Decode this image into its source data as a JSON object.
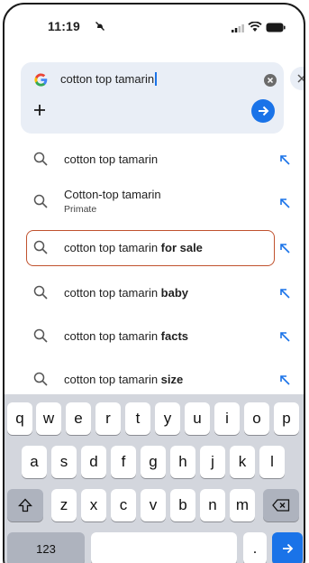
{
  "status_bar": {
    "time": "11:19"
  },
  "search": {
    "query": "cotton top tamarin"
  },
  "suggestions": [
    {
      "prefix": "cotton top tamarin",
      "bold": "",
      "subtitle": ""
    },
    {
      "prefix": "Cotton-top tamarin",
      "bold": "",
      "subtitle": "Primate"
    },
    {
      "prefix": "cotton top tamarin ",
      "bold": "for sale",
      "subtitle": ""
    },
    {
      "prefix": "cotton top tamarin ",
      "bold": "baby",
      "subtitle": ""
    },
    {
      "prefix": "cotton top tamarin ",
      "bold": "facts",
      "subtitle": ""
    },
    {
      "prefix": "cotton top tamarin ",
      "bold": "size",
      "subtitle": ""
    }
  ],
  "keyboard": {
    "row1": [
      "q",
      "w",
      "e",
      "r",
      "t",
      "y",
      "u",
      "i",
      "o",
      "p"
    ],
    "row2": [
      "a",
      "s",
      "d",
      "f",
      "g",
      "h",
      "j",
      "k",
      "l"
    ],
    "row3": [
      "z",
      "x",
      "c",
      "v",
      "b",
      "n",
      "m"
    ],
    "numbers_label": "123",
    "period": "."
  },
  "colors": {
    "accent": "#1a73e8",
    "highlight_border": "#c0522e",
    "card": "#e9eef6"
  }
}
